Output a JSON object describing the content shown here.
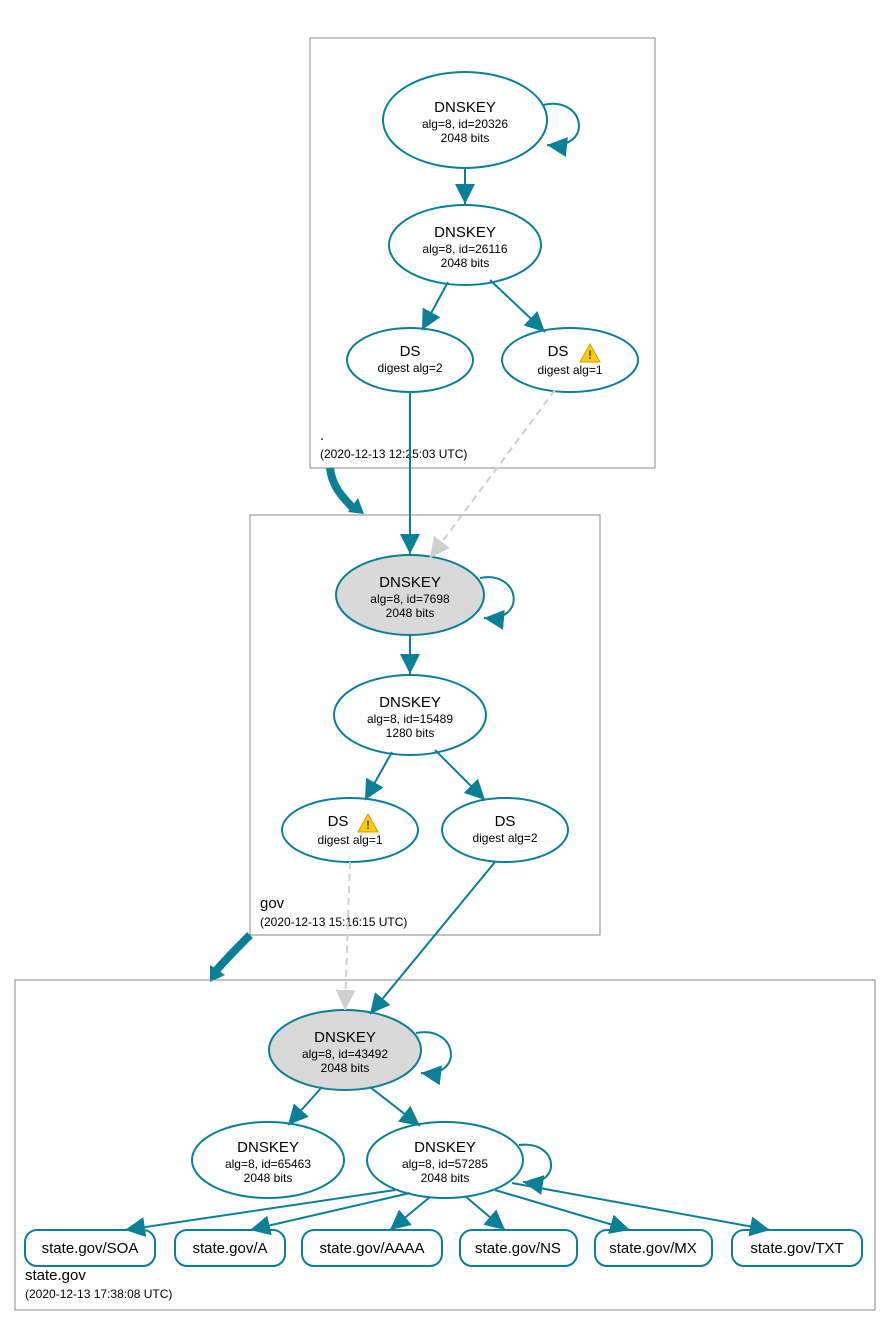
{
  "colors": {
    "stroke": "#0a7f96",
    "ksk_fill": "#d9d9d9"
  },
  "zones": {
    "root": {
      "label": ".",
      "timestamp": "(2020-12-13 12:25:03 UTC)"
    },
    "gov": {
      "label": "gov",
      "timestamp": "(2020-12-13 15:16:15 UTC)"
    },
    "state": {
      "label": "state.gov",
      "timestamp": "(2020-12-13 17:38:08 UTC)"
    }
  },
  "nodes": {
    "root_ksk": {
      "title": "DNSKEY",
      "line1": "alg=8, id=20326",
      "line2": "2048 bits"
    },
    "root_zsk": {
      "title": "DNSKEY",
      "line1": "alg=8, id=26116",
      "line2": "2048 bits"
    },
    "root_ds2": {
      "title": "DS",
      "line1": "digest alg=2"
    },
    "root_ds1": {
      "title": "DS",
      "line1": "digest alg=1",
      "warn": true
    },
    "gov_ksk": {
      "title": "DNSKEY",
      "line1": "alg=8, id=7698",
      "line2": "2048 bits"
    },
    "gov_zsk": {
      "title": "DNSKEY",
      "line1": "alg=8, id=15489",
      "line2": "1280 bits"
    },
    "gov_ds1": {
      "title": "DS",
      "line1": "digest alg=1",
      "warn": true
    },
    "gov_ds2": {
      "title": "DS",
      "line1": "digest alg=2"
    },
    "state_ksk": {
      "title": "DNSKEY",
      "line1": "alg=8, id=43492",
      "line2": "2048 bits"
    },
    "state_zsk1": {
      "title": "DNSKEY",
      "line1": "alg=8, id=65463",
      "line2": "2048 bits"
    },
    "state_zsk2": {
      "title": "DNSKEY",
      "line1": "alg=8, id=57285",
      "line2": "2048 bits"
    }
  },
  "records": {
    "soa": "state.gov/SOA",
    "a": "state.gov/A",
    "aaaa": "state.gov/AAAA",
    "ns": "state.gov/NS",
    "mx": "state.gov/MX",
    "txt": "state.gov/TXT"
  }
}
